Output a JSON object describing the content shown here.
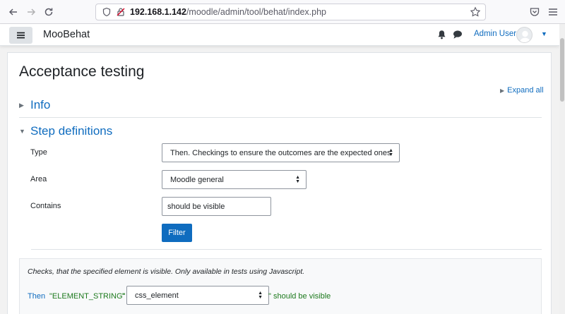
{
  "browser": {
    "url_host": "192.168.1.142",
    "url_path": "/moodle/admin/tool/behat/index.php"
  },
  "navbar": {
    "site_name": "MooBehat",
    "user_name": "Admin User"
  },
  "page": {
    "title": "Acceptance testing",
    "expand_all": "Expand all",
    "sections": {
      "info": "Info",
      "step_definitions": "Step definitions"
    }
  },
  "form": {
    "type_label": "Type",
    "type_value": "Then. Checkings to ensure the outcomes are the expected ones",
    "area_label": "Area",
    "area_value": "Moodle general",
    "contains_label": "Contains",
    "contains_value": "should be visible",
    "filter_button": "Filter"
  },
  "result": {
    "description": "Checks, that the specified element is visible. Only available in tests using Javascript.",
    "keyword": "Then",
    "param": "\"ELEMENT_STRING\"",
    "quote_open": "\"",
    "selector_value": "css_element",
    "tail": "\" should be visible"
  },
  "icons": {
    "back": "arrow-left-icon",
    "forward": "arrow-right-icon",
    "reload": "reload-icon",
    "shield": "shield-icon",
    "lock": "lock-icon",
    "star": "star-icon",
    "pocket": "pocket-icon",
    "menu": "hamburger-icon",
    "bell": "bell-icon",
    "chat": "chat-icon"
  },
  "colors": {
    "link": "#0f6cbf",
    "primary_button": "#0f6cbf",
    "step_param": "#1d7a1d"
  }
}
